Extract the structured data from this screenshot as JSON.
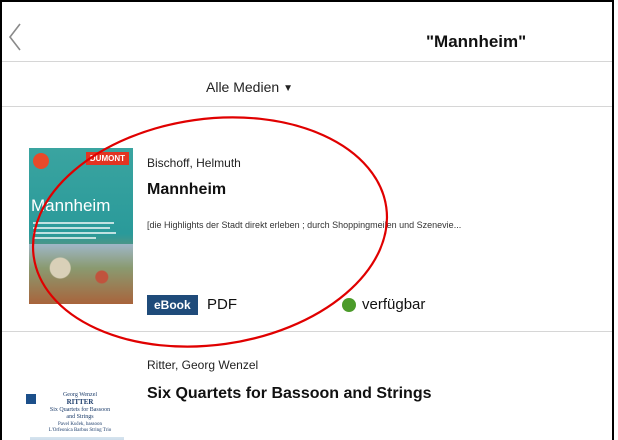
{
  "header": {
    "back_icon": "chevron-left-icon",
    "search_title": "\"Mannheim\""
  },
  "filter": {
    "label": "Alle Medien",
    "caret": "▼"
  },
  "results": [
    {
      "author": "Bischoff, Helmuth",
      "title": "Mannheim",
      "subtitle": "[die Highlights der Stadt direkt erleben ; durch Shoppingmeilen und Szenevie...",
      "media_type": "eBook",
      "format": "PDF",
      "availability": "verfügbar",
      "availability_color": "#4b9b2a",
      "cover": {
        "brand": "DUMONT",
        "title": "Mannheim"
      }
    },
    {
      "author": "Ritter, Georg Wenzel",
      "title": "Six Quartets for Bassoon and Strings",
      "cover": {
        "lines": [
          "Georg Wenzel",
          "RITTER",
          "Six Quartets for Bassoon",
          "and Strings",
          "Pavel Kuček, bassoon",
          "L'Orfeonica Barbus String Trio"
        ]
      }
    }
  ],
  "colors": {
    "ebook_badge": "#1f4b7a",
    "annotation_ellipse": "#e00000"
  }
}
